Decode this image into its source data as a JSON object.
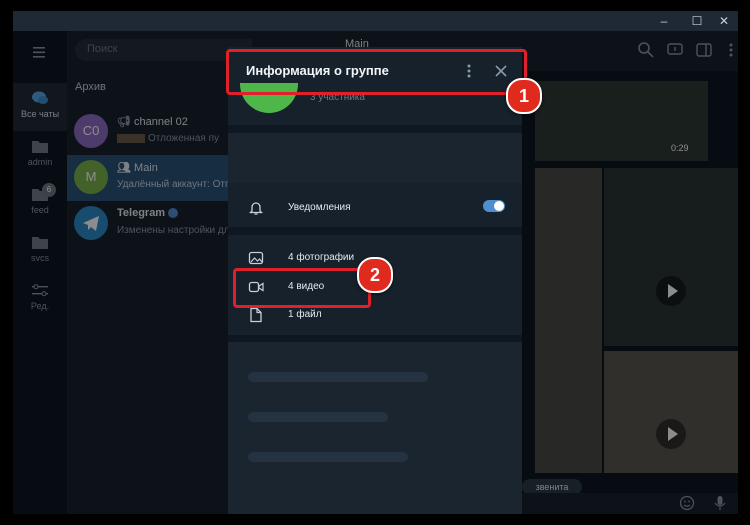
{
  "window": {
    "controls": [
      "–",
      "☐",
      "✕"
    ]
  },
  "folders": [
    {
      "label": "Все чаты",
      "icon": "chat-bubbles-icon",
      "active": true
    },
    {
      "label": "admin",
      "icon": "folder-icon"
    },
    {
      "label": "feed",
      "icon": "folder-icon",
      "badge": "6"
    },
    {
      "label": "svcs",
      "icon": "folder-icon"
    },
    {
      "label": "Ред.",
      "icon": "sliders-icon"
    }
  ],
  "search": {
    "placeholder": "Поиск"
  },
  "chatlist": {
    "section": "Архив",
    "chats": [
      {
        "initials": "C0",
        "name": "channel 02",
        "preview": "Отложенная пу",
        "avatar_color": "#8c6dc3"
      },
      {
        "initials": "M",
        "name": "Main",
        "preview": "Удалённый аккаунт: Отправ",
        "avatar_color": "#7bb34e"
      },
      {
        "initials": "",
        "name": "Telegram",
        "preview": "Изменены настройки дл",
        "avatar_color": "#2a8ac9"
      }
    ]
  },
  "chat": {
    "title": "Main",
    "video_time": "0:29",
    "bottom_label": "звенита"
  },
  "modal": {
    "title": "Информация о группе",
    "subtitle": "3 участника",
    "notifications": "Уведомления",
    "media": [
      {
        "label": "4 фотографии",
        "icon": "photo-icon"
      },
      {
        "label": "4 видео",
        "icon": "video-icon"
      },
      {
        "label": "1 файл",
        "icon": "file-icon"
      }
    ]
  },
  "annotations": [
    "1",
    "2"
  ],
  "colors": {
    "accent": "#4f8fd0",
    "highlight": "#e0202a",
    "selected": "#2b5278"
  }
}
